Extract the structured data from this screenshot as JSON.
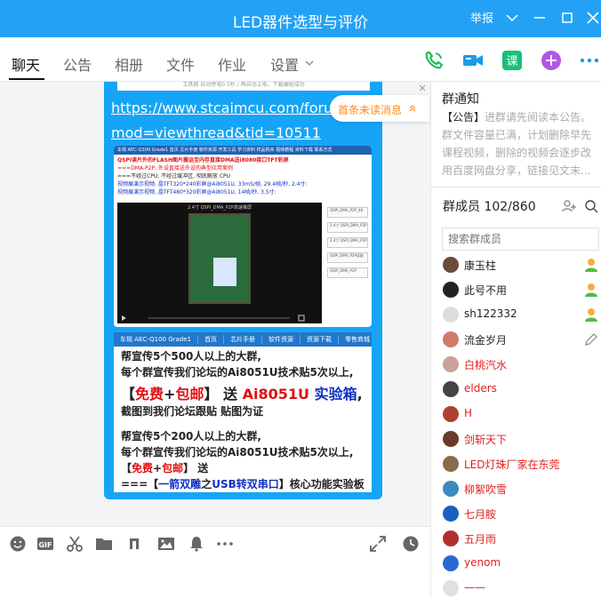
{
  "window": {
    "title": "LED器件选型与评价",
    "report_label": "举报"
  },
  "tabs": [
    "聊天",
    "公告",
    "相册",
    "文件",
    "作业",
    "设置"
  ],
  "chat": {
    "link_line1": "https://www.stcaimcu.com/forum.php?",
    "link_line2": "mod=viewthread&tid=10511",
    "unread_label": "首条未读消息",
    "top_strip": "工具器 自动停电0.5秒 / 再自动上电，下载编程成功",
    "shot1": {
      "nav": "车规 AEC-Q100 Grade1   首页   芯片手册   软件资源   开发工具   学习资料   样品购买   视频教程   资料下载   联系方式",
      "lines": [
        "QSPI读片外的FLASH图片搬运至内存直接DMA送i8080接口TFT彩屏",
        "===DMA-P2P, 外设直接送外设的典型应用案例",
        "===不经过CPU, 不经过缓冲区, 彻底解放 CPU",
        "视频展演示视频, 晶TFT320*240彩屏@Ai8051U, 33mS/帧, 29.4帧/秒, 2.4寸:",
        "视频展演示视频, 晶TFT480*320彩屏@Ai8051U, 14帧/秒, 3.5寸:"
      ],
      "player_title": "2.4寸 QSPI_DMA_P2P高速推屏",
      "side_items": [
        "QSPI_DMA_P2P_48",
        "2.4寸 QSPI_DMA_P2P",
        "2.4寸 QSPI_DMA_P2P",
        "QSPI_DMA_P2P读取",
        "QSPI_DMA_P2P"
      ]
    },
    "shot2": {
      "nav": [
        "车规 AEC-Q100 Grade1",
        "首页",
        "芯片手册",
        "软件资源",
        "资源下载",
        "零售商城"
      ],
      "line1": "帮宣传5个500人以上的大群,",
      "line2": "每个群宣传我们论坛的Ai8051U技术贴5次以上,",
      "line3_a": "【",
      "line3_b": "免费",
      "line3_c": "+",
      "line3_d": "包邮",
      "line3_e": "】 送 ",
      "line3_f": "Ai8051U",
      "line3_g": " 实验箱",
      "line3_h": ",",
      "line4": "截图到我们论坛跟贴 贴图为证",
      "line5": "帮宣传5个200人以上的大群,",
      "line6": "每个群宣传我们论坛的Ai8051U技术贴5次以上,",
      "line7_a": "【",
      "line7_b": "免费",
      "line7_c": "+",
      "line7_d": "包邮",
      "line7_e": "】 送",
      "line8_a": "===【",
      "line8_b": "一箭双雕",
      "line8_c": "之",
      "line8_d": "USB转双串口",
      "line8_e": "】核心功能实验板"
    }
  },
  "notice": {
    "title": "群通知",
    "bracket": "【公告】",
    "text": "进群请先阅读本公告。群文件容量已满，计划删除早先课程视频，删除的视频会逐步改用百度网盘分享，链接见文末..."
  },
  "members": {
    "header": "群成员 102/860",
    "search_placeholder": "搜索群成员",
    "list": [
      {
        "name": "康玉柱",
        "color": "#222222",
        "badge": "person-icon"
      },
      {
        "name": "此号不用",
        "color": "#222222",
        "badge": "person-icon"
      },
      {
        "name": "sh122332",
        "color": "#222222",
        "badge": "person-icon"
      },
      {
        "name": "流金岁月",
        "color": "#222222",
        "badge": "pencil-icon"
      },
      {
        "name": "白桃汽水",
        "color": "#e02020",
        "badge": ""
      },
      {
        "name": "elders",
        "color": "#e02020",
        "badge": ""
      },
      {
        "name": "H",
        "color": "#e02020",
        "badge": ""
      },
      {
        "name": "剑斩天下",
        "color": "#e02020",
        "badge": ""
      },
      {
        "name": "LED灯珠厂家在东莞",
        "color": "#e02020",
        "badge": ""
      },
      {
        "name": "柳絮吹雪",
        "color": "#e02020",
        "badge": ""
      },
      {
        "name": "七月胺",
        "color": "#e02020",
        "badge": ""
      },
      {
        "name": "五月雨",
        "color": "#e02020",
        "badge": ""
      },
      {
        "name": "yenom",
        "color": "#e02020",
        "badge": ""
      },
      {
        "name": "——",
        "color": "#e02020",
        "badge": ""
      }
    ]
  },
  "colors": {
    "accent": "#23a2f5",
    "bubble": "#16a5f6",
    "unread": "#ff8a1f",
    "admin_name": "#e02020"
  }
}
